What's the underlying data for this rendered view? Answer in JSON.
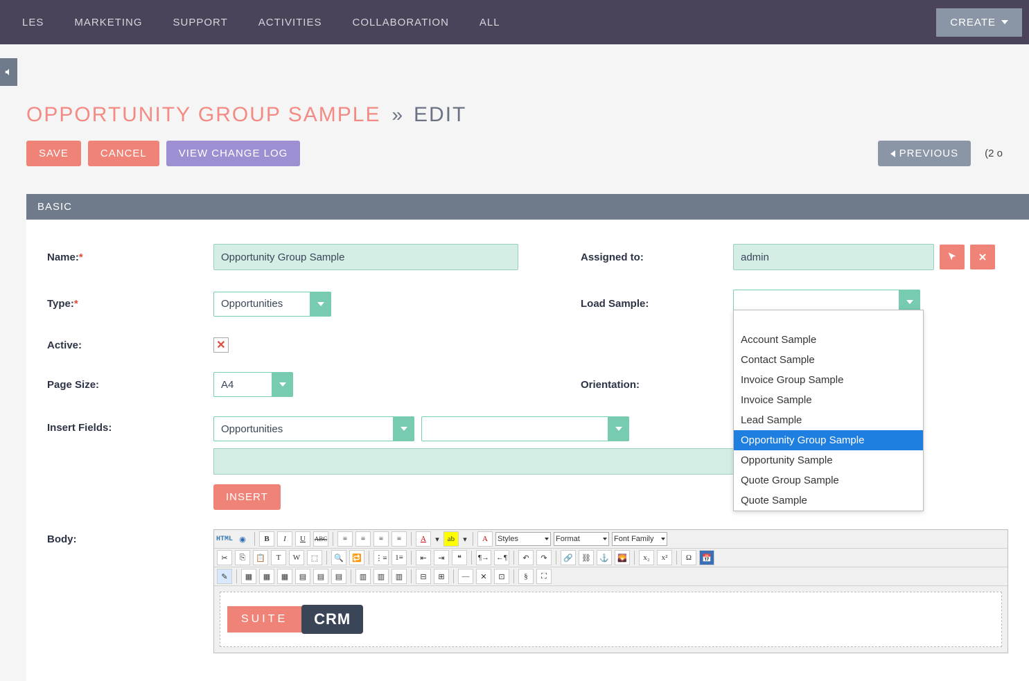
{
  "nav": {
    "items": [
      "LES",
      "MARKETING",
      "SUPPORT",
      "ACTIVITIES",
      "COLLABORATION",
      "ALL"
    ],
    "create": "CREATE"
  },
  "page": {
    "title": "OPPORTUNITY GROUP SAMPLE",
    "sep": "»",
    "mode": "EDIT"
  },
  "actions": {
    "save": "SAVE",
    "cancel": "CANCEL",
    "log": "VIEW CHANGE LOG",
    "prev": "PREVIOUS",
    "pager": "(2 o"
  },
  "section": {
    "basic": "BASIC"
  },
  "form": {
    "name_label": "Name:",
    "name_value": "Opportunity Group Sample",
    "assigned_label": "Assigned to:",
    "assigned_value": "admin",
    "type_label": "Type:",
    "type_value": "Opportunities",
    "load_label": "Load Sample:",
    "load_value": "",
    "active_label": "Active:",
    "pagesize_label": "Page Size:",
    "pagesize_value": "A4",
    "orientation_label": "Orientation:",
    "insert_label": "Insert Fields:",
    "insert_value": "Opportunities",
    "insert_btn": "INSERT",
    "body_label": "Body:"
  },
  "load_options": [
    "Account Sample",
    "Contact Sample",
    "Invoice Group Sample",
    "Invoice Sample",
    "Lead Sample",
    "Opportunity Group Sample",
    "Opportunity Sample",
    "Quote Group Sample",
    "Quote Sample"
  ],
  "load_highlight": "Opportunity Group Sample",
  "rte": {
    "html": "HTML",
    "styles": "Styles",
    "format": "Format",
    "fontfamily": "Font Family",
    "logo_suite": "SUITE",
    "logo_crm": "CRM"
  }
}
